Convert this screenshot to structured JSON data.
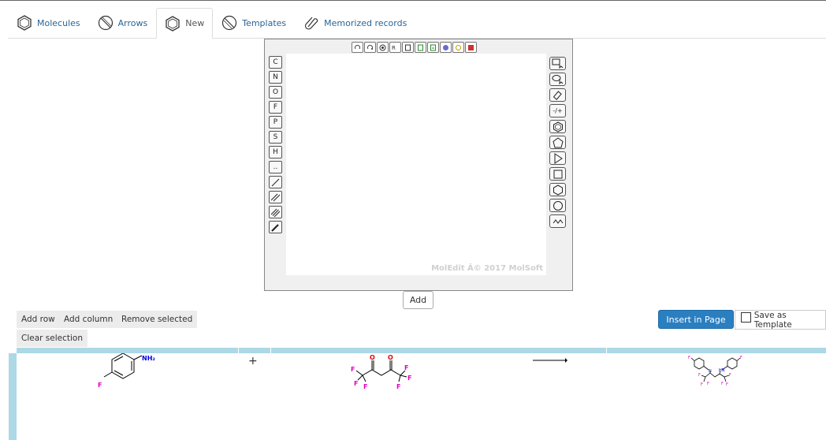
{
  "tabs": [
    {
      "label": "Molecules",
      "icon": "benzene-icon"
    },
    {
      "label": "Arrows",
      "icon": "arrows-icon"
    },
    {
      "label": "New",
      "icon": "benzene-icon",
      "active": true
    },
    {
      "label": "Templates",
      "icon": "templates-icon"
    },
    {
      "label": "Memorized records",
      "icon": "paperclip-icon"
    }
  ],
  "editor": {
    "watermark": "MolEdit Â© 2017 MolSoft",
    "left_tools": [
      "C",
      "N",
      "O",
      "F",
      "P",
      "S",
      "H",
      ".."
    ],
    "right_tools": {
      "charge_label": "-/+"
    }
  },
  "add_label": "Add",
  "buttons": {
    "add_row": "Add row",
    "add_column": "Add column",
    "remove_selected": "Remove selected",
    "clear_selection": "Clear selection",
    "insert_in_page": "Insert in Page",
    "save_as_template": "Save as Template"
  },
  "reaction": {
    "plus": "+",
    "reactant1": {
      "nh2": "NH₂",
      "f": "F"
    },
    "reactant2": {
      "o": "O",
      "f": "F"
    },
    "product": {
      "f": "F",
      "n": "N",
      "hn": "HN"
    }
  },
  "colors": {
    "accent": "#2a7fc1",
    "table": "#add8e6",
    "fluorine": "#e000c0",
    "oxygen": "#e00000",
    "nitrogen": "#0000e0"
  }
}
